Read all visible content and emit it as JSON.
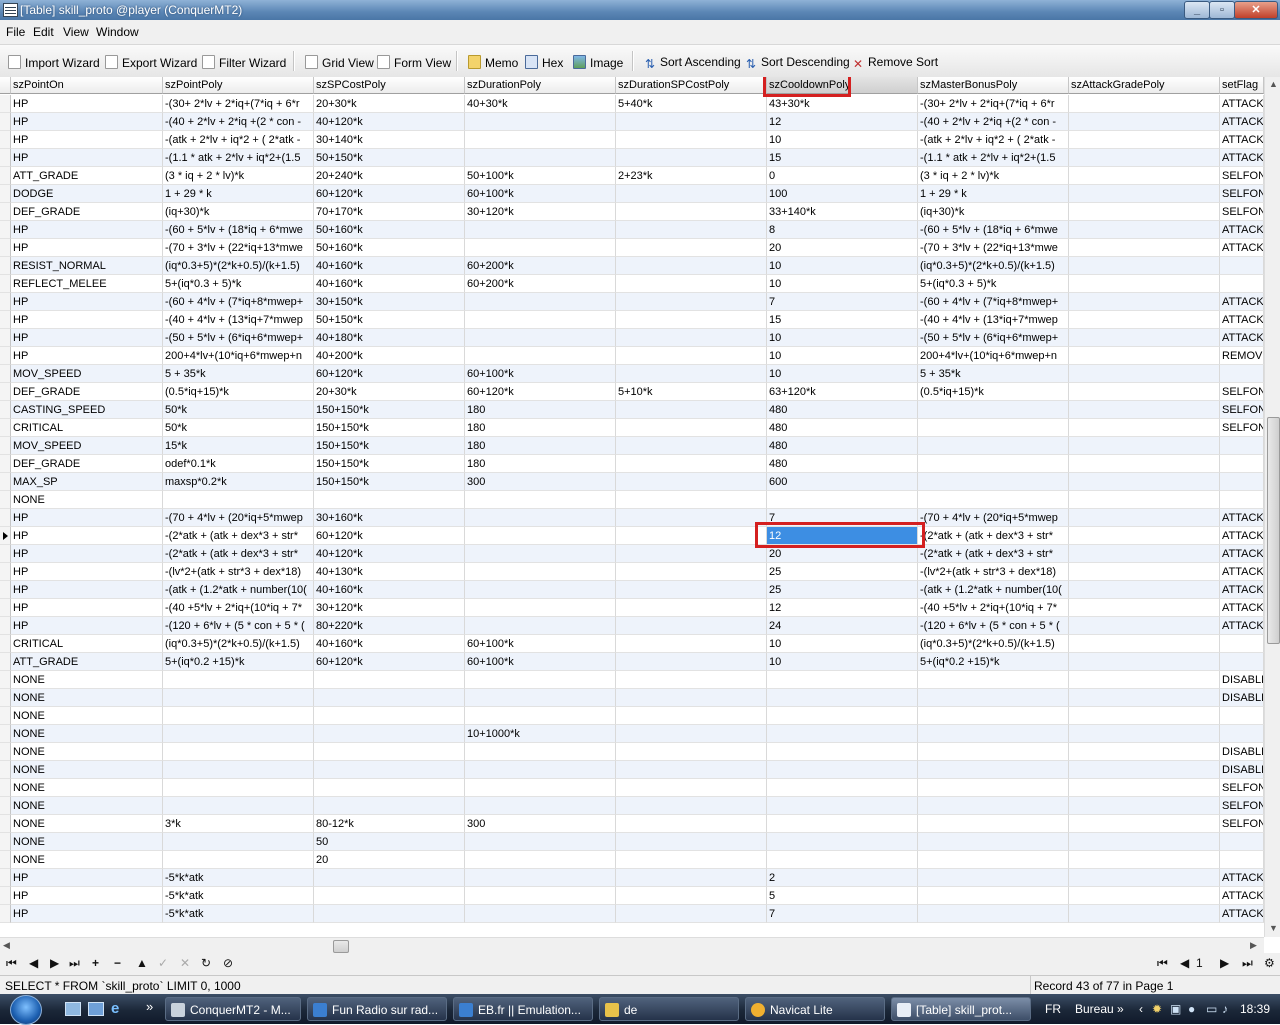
{
  "window": {
    "title": "[Table] skill_proto @player (ConquerMT2)"
  },
  "menu": [
    "File",
    "Edit",
    "View",
    "Window"
  ],
  "toolbar": {
    "import_wizard": "Import Wizard",
    "export_wizard": "Export Wizard",
    "filter_wizard": "Filter Wizard",
    "grid_view": "Grid View",
    "form_view": "Form View",
    "memo": "Memo",
    "hex": "Hex",
    "image": "Image",
    "sort_ascending": "Sort Ascending",
    "sort_descending": "Sort Descending",
    "remove_sort": "Remove Sort"
  },
  "grid": {
    "columns": [
      "szPointOn",
      "szPointPoly",
      "szSPCostPoly",
      "szDurationPoly",
      "szDurationSPCostPoly",
      "szCooldownPoly",
      "szMasterBonusPoly",
      "szAttackGradePoly",
      "setFlag"
    ],
    "highlighted_column": "szCooldownPoly",
    "selected_row_index": 24,
    "rows": [
      [
        "HP",
        "-(30+ 2*lv + 2*iq+(7*iq + 6*r",
        "20+30*k",
        "40+30*k",
        "5+40*k",
        "43+30*k",
        "-(30+ 2*lv + 2*iq+(7*iq + 6*r",
        "",
        "ATTACK"
      ],
      [
        "HP",
        "-(40 + 2*lv + 2*iq +(2 * con -",
        "40+120*k",
        "",
        "",
        "12",
        "-(40 + 2*lv + 2*iq +(2 * con -",
        "",
        "ATTACK"
      ],
      [
        "HP",
        "-(atk + 2*lv + iq*2 + ( 2*atk -",
        "30+140*k",
        "",
        "",
        "10",
        "-(atk + 2*lv + iq*2 + ( 2*atk -",
        "",
        "ATTACK"
      ],
      [
        "HP",
        "-(1.1 * atk + 2*lv + iq*2+(1.5",
        "50+150*k",
        "",
        "",
        "15",
        "-(1.1 * atk + 2*lv + iq*2+(1.5",
        "",
        "ATTACK"
      ],
      [
        "ATT_GRADE",
        "(3 * iq + 2 * lv)*k",
        "20+240*k",
        "50+100*k",
        "2+23*k",
        "0",
        "(3 * iq + 2 * lv)*k",
        "",
        "SELFONI"
      ],
      [
        "DODGE",
        "1 + 29 * k",
        "60+120*k",
        "60+100*k",
        "",
        "100",
        "1 + 29 * k",
        "",
        "SELFONI"
      ],
      [
        "DEF_GRADE",
        "(iq+30)*k",
        "70+170*k",
        "30+120*k",
        "",
        "33+140*k",
        "(iq+30)*k",
        "",
        "SELFONI"
      ],
      [
        "HP",
        "-(60 + 5*lv + (18*iq + 6*mwe",
        "50+160*k",
        "",
        "",
        "8",
        "-(60 + 5*lv + (18*iq + 6*mwe",
        "",
        "ATTACK"
      ],
      [
        "HP",
        "-(70 + 3*lv + (22*iq+13*mwe",
        "50+160*k",
        "",
        "",
        "20",
        "-(70 + 3*lv + (22*iq+13*mwe",
        "",
        "ATTACK"
      ],
      [
        "RESIST_NORMAL",
        "(iq*0.3+5)*(2*k+0.5)/(k+1.5)",
        "40+160*k",
        "60+200*k",
        "",
        "10",
        "(iq*0.3+5)*(2*k+0.5)/(k+1.5)",
        "",
        ""
      ],
      [
        "REFLECT_MELEE",
        "5+(iq*0.3 + 5)*k",
        "40+160*k",
        "60+200*k",
        "",
        "10",
        "5+(iq*0.3 + 5)*k",
        "",
        ""
      ],
      [
        "HP",
        "-(60 + 4*lv + (7*iq+8*mwep+",
        "30+150*k",
        "",
        "",
        "7",
        "-(60 + 4*lv + (7*iq+8*mwep+",
        "",
        "ATTACK"
      ],
      [
        "HP",
        "-(40 + 4*lv + (13*iq+7*mwep",
        "50+150*k",
        "",
        "",
        "15",
        "-(40 + 4*lv + (13*iq+7*mwep",
        "",
        "ATTACK"
      ],
      [
        "HP",
        "-(50 + 5*lv + (6*iq+6*mwep+",
        "40+180*k",
        "",
        "",
        "10",
        "-(50 + 5*lv + (6*iq+6*mwep+",
        "",
        "ATTACK"
      ],
      [
        "HP",
        "200+4*lv+(10*iq+6*mwep+n",
        "40+200*k",
        "",
        "",
        "10",
        "200+4*lv+(10*iq+6*mwep+n",
        "",
        "REMOVE"
      ],
      [
        "MOV_SPEED",
        "5 + 35*k",
        "60+120*k",
        "60+100*k",
        "",
        "10",
        "5 + 35*k",
        "",
        ""
      ],
      [
        "DEF_GRADE",
        "(0.5*iq+15)*k",
        "20+30*k",
        "60+120*k",
        "5+10*k",
        "63+120*k",
        "(0.5*iq+15)*k",
        "",
        "SELFONI"
      ],
      [
        "CASTING_SPEED",
        "50*k",
        "150+150*k",
        "180",
        "",
        "480",
        "",
        "",
        "SELFONI"
      ],
      [
        "CRITICAL",
        "50*k",
        "150+150*k",
        "180",
        "",
        "480",
        "",
        "",
        "SELFONI"
      ],
      [
        "MOV_SPEED",
        "15*k",
        "150+150*k",
        "180",
        "",
        "480",
        "",
        "",
        ""
      ],
      [
        "DEF_GRADE",
        "odef*0.1*k",
        "150+150*k",
        "180",
        "",
        "480",
        "",
        "",
        ""
      ],
      [
        "MAX_SP",
        "maxsp*0.2*k",
        "150+150*k",
        "300",
        "",
        "600",
        "",
        "",
        ""
      ],
      [
        "NONE",
        "",
        "",
        "",
        "",
        "",
        "",
        "",
        ""
      ],
      [
        "HP",
        "-(70 + 4*lv + (20*iq+5*mwep",
        "30+160*k",
        "",
        "",
        "7",
        "-(70 + 4*lv + (20*iq+5*mwep",
        "",
        "ATTACK"
      ],
      [
        "HP",
        "-(2*atk + (atk + dex*3 + str*",
        "60+120*k",
        "",
        "",
        "12",
        "-(2*atk + (atk + dex*3 + str*",
        "",
        "ATTACK"
      ],
      [
        "HP",
        "-(2*atk + (atk + dex*3 + str*",
        "40+120*k",
        "",
        "",
        "20",
        "-(2*atk + (atk + dex*3 + str*",
        "",
        "ATTACK"
      ],
      [
        "HP",
        "-(lv*2+(atk + str*3 + dex*18)",
        "40+130*k",
        "",
        "",
        "25",
        "-(lv*2+(atk + str*3 + dex*18)",
        "",
        "ATTACK"
      ],
      [
        "HP",
        "-(atk + (1.2*atk + number(10(",
        "40+160*k",
        "",
        "",
        "25",
        "-(atk + (1.2*atk + number(10(",
        "",
        "ATTACK"
      ],
      [
        "HP",
        "-(40 +5*lv + 2*iq+(10*iq + 7*",
        "30+120*k",
        "",
        "",
        "12",
        "-(40 +5*lv + 2*iq+(10*iq + 7*",
        "",
        "ATTACK"
      ],
      [
        "HP",
        "-(120 + 6*lv + (5 * con + 5 * (",
        "80+220*k",
        "",
        "",
        "24",
        "-(120 + 6*lv + (5 * con + 5 * (",
        "",
        "ATTACK"
      ],
      [
        "CRITICAL",
        "(iq*0.3+5)*(2*k+0.5)/(k+1.5)",
        "40+160*k",
        "60+100*k",
        "",
        "10",
        "(iq*0.3+5)*(2*k+0.5)/(k+1.5)",
        "",
        ""
      ],
      [
        "ATT_GRADE",
        "5+(iq*0.2 +15)*k",
        "60+120*k",
        "60+100*k",
        "",
        "10",
        "5+(iq*0.2 +15)*k",
        "",
        ""
      ],
      [
        "NONE",
        "",
        "",
        "",
        "",
        "",
        "",
        "",
        "DISABLE"
      ],
      [
        "NONE",
        "",
        "",
        "",
        "",
        "",
        "",
        "",
        "DISABLE"
      ],
      [
        "NONE",
        "",
        "",
        "",
        "",
        "",
        "",
        "",
        ""
      ],
      [
        "NONE",
        "",
        "",
        "10+1000*k",
        "",
        "",
        "",
        "",
        ""
      ],
      [
        "NONE",
        "",
        "",
        "",
        "",
        "",
        "",
        "",
        "DISABLE"
      ],
      [
        "NONE",
        "",
        "",
        "",
        "",
        "",
        "",
        "",
        "DISABLE"
      ],
      [
        "NONE",
        "",
        "",
        "",
        "",
        "",
        "",
        "",
        "SELFONI"
      ],
      [
        "NONE",
        "",
        "",
        "",
        "",
        "",
        "",
        "",
        "SELFONI"
      ],
      [
        "NONE",
        "3*k",
        "80-12*k",
        "300",
        "",
        "",
        "",
        "",
        "SELFONI"
      ],
      [
        "NONE",
        "",
        "50",
        "",
        "",
        "",
        "",
        "",
        ""
      ],
      [
        "NONE",
        "",
        "20",
        "",
        "",
        "",
        "",
        "",
        ""
      ],
      [
        "HP",
        "-5*k*atk",
        "",
        "",
        "",
        "2",
        "",
        "",
        "ATTACK"
      ],
      [
        "HP",
        "-5*k*atk",
        "",
        "",
        "",
        "5",
        "",
        "",
        "ATTACK"
      ],
      [
        "HP",
        "-5*k*atk",
        "",
        "",
        "",
        "7",
        "",
        "",
        "ATTACK"
      ]
    ]
  },
  "navigator": {
    "page": "1"
  },
  "status": {
    "query": "SELECT * FROM `skill_proto` LIMIT 0, 1000",
    "record_info": "Record 43 of 77 in Page 1"
  },
  "taskbar": {
    "tasks": [
      "ConquerMT2 - M...",
      "Fun Radio sur rad...",
      "EB.fr || Emulation...",
      "de",
      "Navicat Lite",
      "[Table] skill_prot..."
    ],
    "lang": "FR",
    "desktop": "Bureau",
    "time": "18:39"
  },
  "colors": {
    "selection": "#3d8ee3",
    "highlight_box": "#d42020",
    "alt_row": "#eef3fb"
  }
}
